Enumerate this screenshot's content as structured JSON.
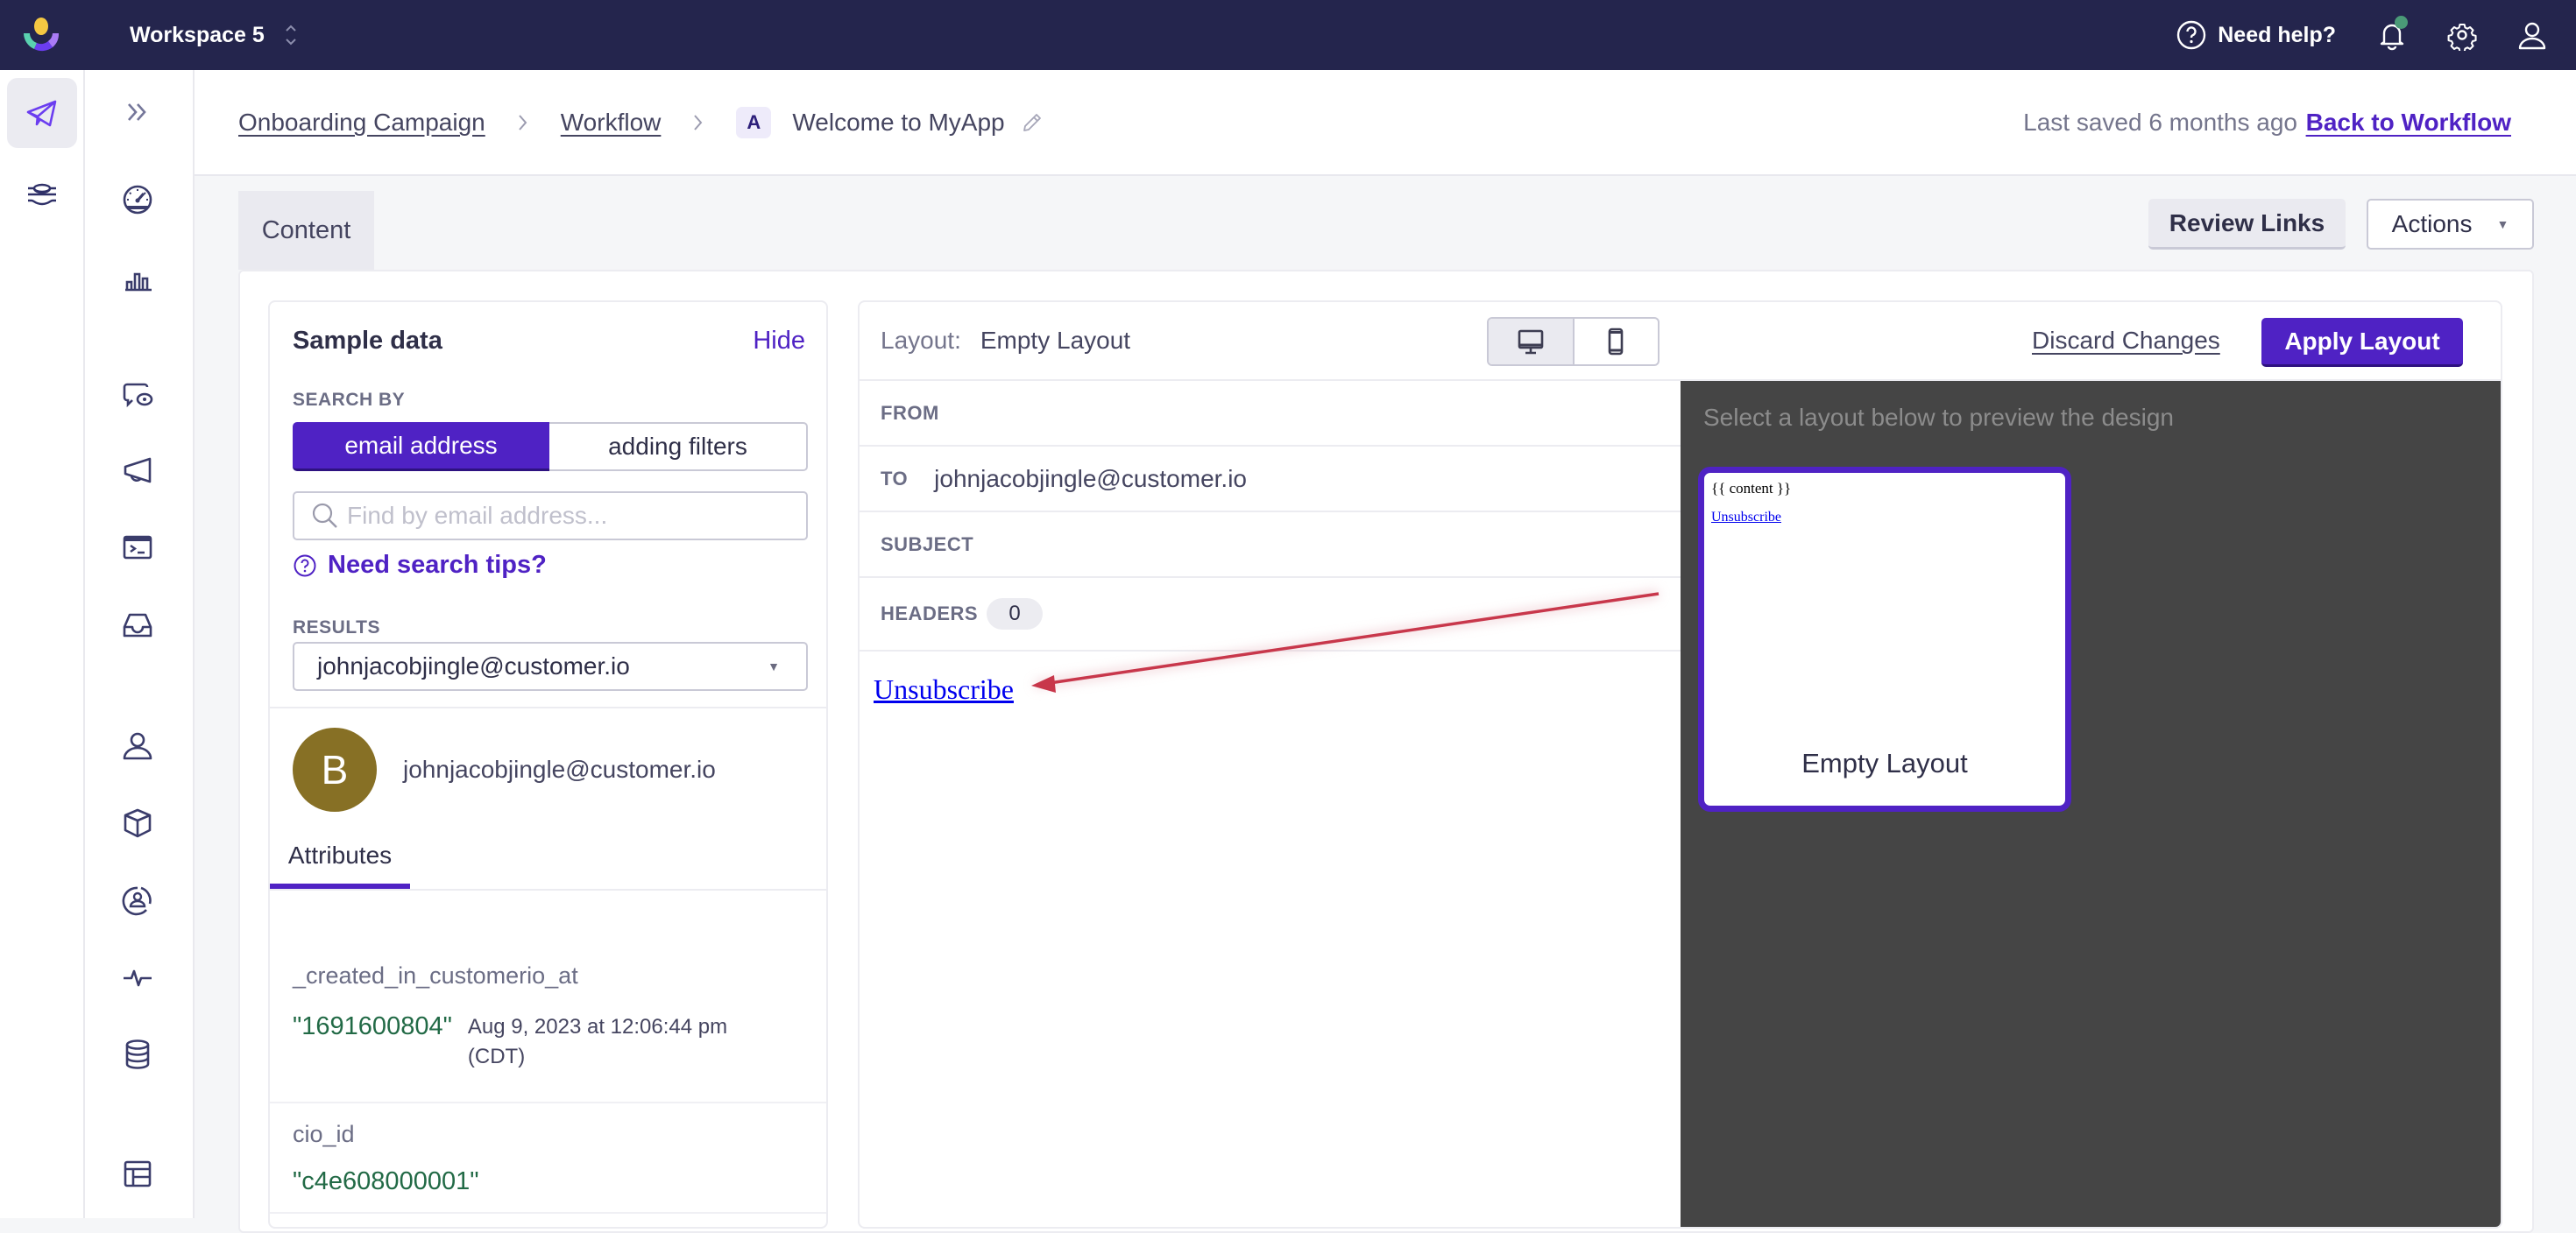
{
  "topbar": {
    "workspace": "Workspace 5",
    "help_label": "Need help?",
    "colors": {
      "background": "#24254d",
      "notification_dot": "#4a9a77"
    }
  },
  "rail_primary": [
    {
      "icon": "paper-plane-icon",
      "label": "Messaging",
      "active": true
    },
    {
      "icon": "data-pipelines-icon",
      "label": "Data Pipelines",
      "active": false
    }
  ],
  "rail_secondary": [
    {
      "icon": "expand-chevrons-icon"
    },
    {
      "icon": "dashboard-gauge-icon"
    },
    {
      "icon": "bar-chart-icon"
    },
    {
      "icon": "message-preview-icon"
    },
    {
      "icon": "megaphone-icon"
    },
    {
      "icon": "terminal-icon"
    },
    {
      "icon": "inbox-icon"
    },
    {
      "icon": "person-icon"
    },
    {
      "icon": "cube-icon"
    },
    {
      "icon": "segment-person-icon"
    },
    {
      "icon": "activity-pulse-icon"
    },
    {
      "icon": "database-icon"
    },
    {
      "icon": "table-icon"
    }
  ],
  "breadcrumb": {
    "items": [
      "Onboarding Campaign",
      "Workflow"
    ],
    "variant": "A",
    "title": "Welcome to MyApp",
    "last_saved": "Last saved 6 months ago",
    "back_link": "Back to Workflow"
  },
  "tabs": {
    "content": "Content"
  },
  "toolbar": {
    "review_links": "Review Links",
    "actions": "Actions"
  },
  "sample_data": {
    "title": "Sample data",
    "hide": "Hide",
    "search_by_label": "SEARCH BY",
    "search_modes": [
      "email address",
      "adding filters"
    ],
    "active_mode": "email address",
    "search_placeholder": "Find by email address...",
    "search_value": "",
    "tips": "Need search tips?",
    "results_label": "RESULTS",
    "results_selected": "johnjacobjingle@customer.io",
    "profile": {
      "initial": "B",
      "email": "johnjacobjingle@customer.io",
      "avatar_color": "#877025"
    },
    "attributes_tab": "Attributes",
    "attributes": [
      {
        "name": "_created_in_customerio_at",
        "value": "\"1691600804\"",
        "formatted": "Aug 9, 2023 at 12:06:44 pm",
        "tz": "(CDT)"
      },
      {
        "name": "cio_id",
        "value": "\"c4e608000001\""
      }
    ]
  },
  "email": {
    "layout_label": "Layout:",
    "layout_value": "Empty Layout",
    "device_modes": [
      "desktop",
      "mobile"
    ],
    "active_device": "desktop",
    "discard": "Discard Changes",
    "apply": "Apply Layout",
    "fields": {
      "from_label": "FROM",
      "from_value": "",
      "to_label": "TO",
      "to_value": "johnjacobjingle@customer.io",
      "subject_label": "SUBJECT",
      "subject_value": "",
      "headers_label": "HEADERS",
      "headers_count": "0"
    },
    "body_link": "Unsubscribe",
    "annotation_color": "#c8374b"
  },
  "preview": {
    "hint": "Select a layout below to preview the design",
    "layouts": [
      {
        "name": "Empty Layout",
        "content_placeholder": "{{ content }}",
        "link": "Unsubscribe",
        "selected": true
      }
    ]
  },
  "colors": {
    "accent": "#4f22c4",
    "value_green": "#226a46",
    "preview_bg": "#454545"
  }
}
